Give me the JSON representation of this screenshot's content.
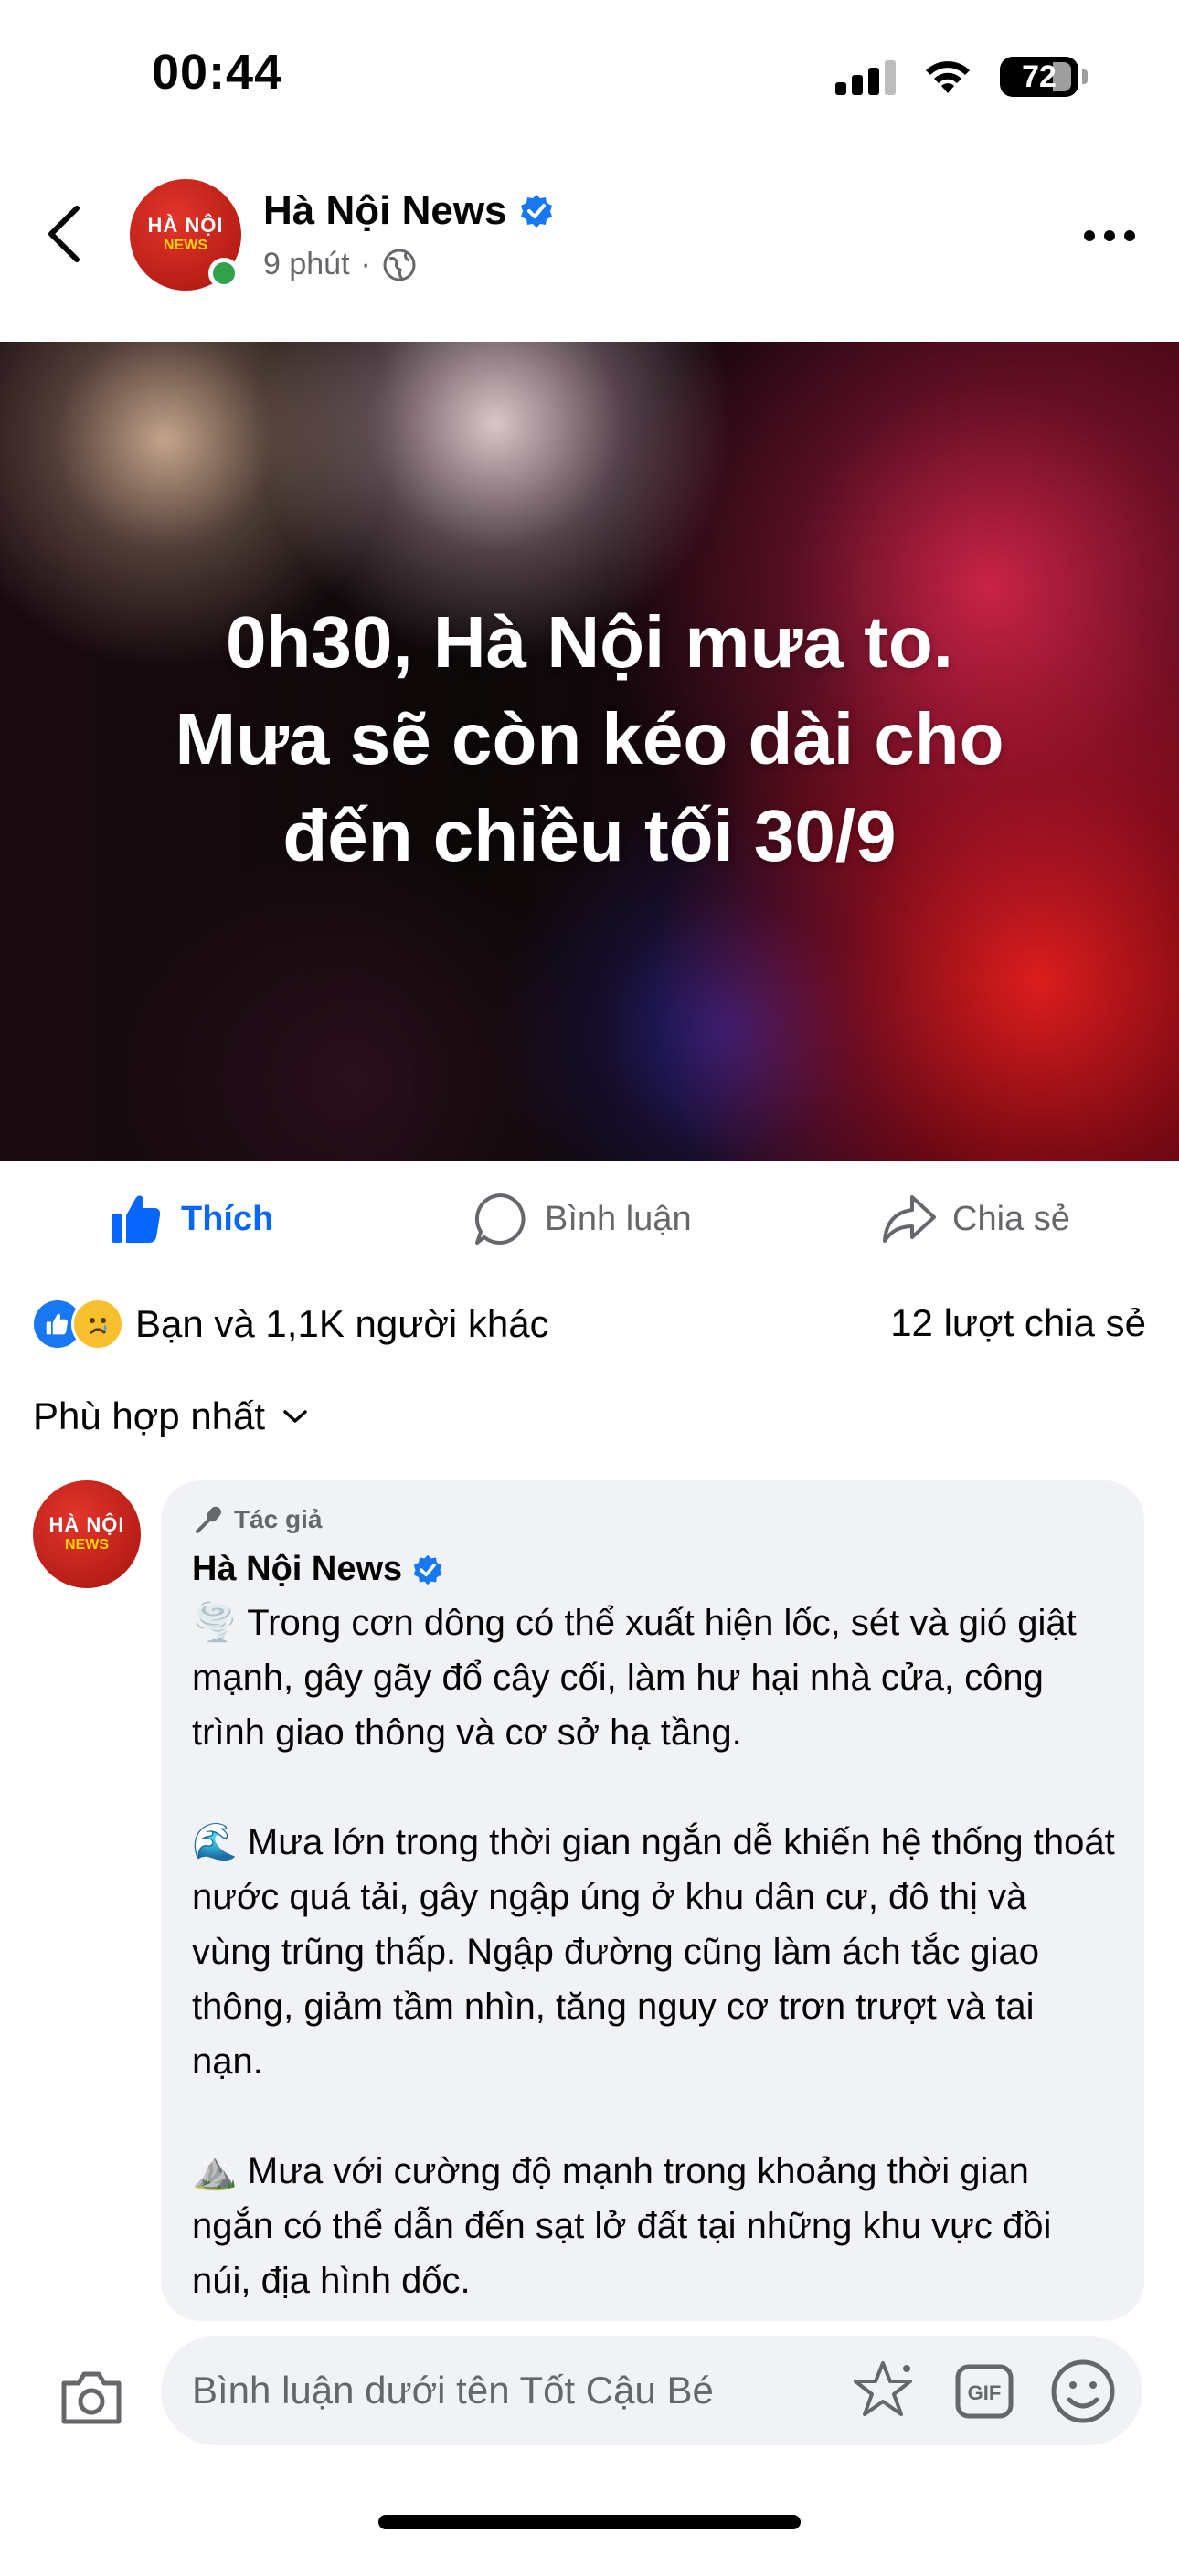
{
  "status_bar": {
    "time": "00:44",
    "battery": "72"
  },
  "post": {
    "page_name": "Hà Nội News",
    "time": "9 phút",
    "separator": "·",
    "logo_top": "HÀ NỘI",
    "logo_bottom": "NEWS",
    "image_text": [
      "0h30, Hà Nội mưa to.",
      "Mưa sẽ còn kéo dài cho",
      "đến chiều tối 30/9"
    ]
  },
  "actions": {
    "like": "Thích",
    "comment": "Bình luận",
    "share": "Chia sẻ"
  },
  "reactions": {
    "summary": "Bạn và 1,1K người khác",
    "shares": "12 lượt chia sẻ"
  },
  "sort": {
    "label": "Phù hợp nhất"
  },
  "comment": {
    "author_tag": "Tác giả",
    "author": "Hà Nội News",
    "paragraphs": [
      "🌪️ Trong cơn dông có thể xuất hiện lốc, sét và gió giật mạnh, gây gãy đổ cây cối, làm hư hại nhà cửa, công trình giao thông và cơ sở hạ tầng.",
      "🌊 Mưa lớn trong thời gian ngắn dễ khiến hệ thống thoát nước quá tải, gây ngập úng ở khu dân cư, đô thị và vùng trũng thấp. Ngập đường cũng làm ách tắc giao thông, giảm tầm nhìn, tăng nguy cơ trơn trượt và tai nạn.",
      "⛰️ Mưa với cường độ mạnh trong khoảng thời gian ngắn có thể dẫn đến sạt lở đất tại những khu vực đồi núi, địa hình dốc."
    ]
  },
  "composer": {
    "placeholder": "Bình luận dưới tên Tốt Cậu Bé"
  },
  "colors": {
    "brand_blue": "#0866ff",
    "muted": "#65676b",
    "online": "#31a24c",
    "bubble": "#f0f2f5"
  }
}
